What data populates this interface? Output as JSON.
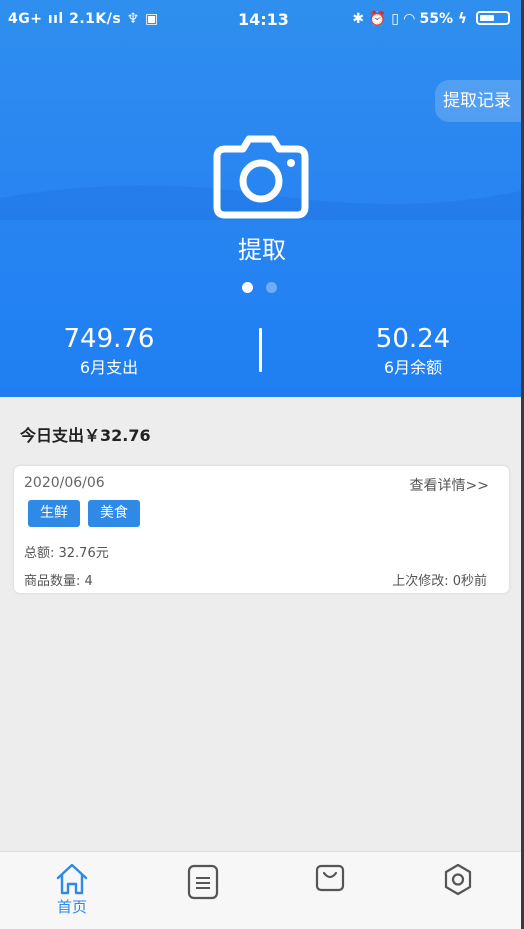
{
  "status_bar": {
    "left": "4G+ ııl 2.1K/s ♆ ▣",
    "time": "14:13",
    "battery_percent": "55%",
    "battery_level": 0.55
  },
  "header": {
    "record_button": "提取记录",
    "extract_label": "提取",
    "carousel_active_index": 0,
    "carousel_count": 2,
    "stats": [
      {
        "value": "749.76",
        "label": "6月支出"
      },
      {
        "value": "50.24",
        "label": "6月余额"
      }
    ]
  },
  "today": {
    "text": "今日支出￥32.76"
  },
  "records": [
    {
      "date": "2020/06/06",
      "detail_link": "查看详情>>",
      "tags": [
        "生鲜",
        "美食"
      ],
      "total": "总额: 32.76元",
      "count": "商品数量: 4",
      "modified": "上次修改: 0秒前"
    }
  ],
  "nav": {
    "home_label": "首页",
    "icons": [
      "home-icon",
      "list-icon",
      "bag-icon",
      "settings-icon"
    ]
  },
  "colors": {
    "primary": "#2a86f1",
    "tag": "#2e8ae6",
    "background": "#ededed"
  }
}
